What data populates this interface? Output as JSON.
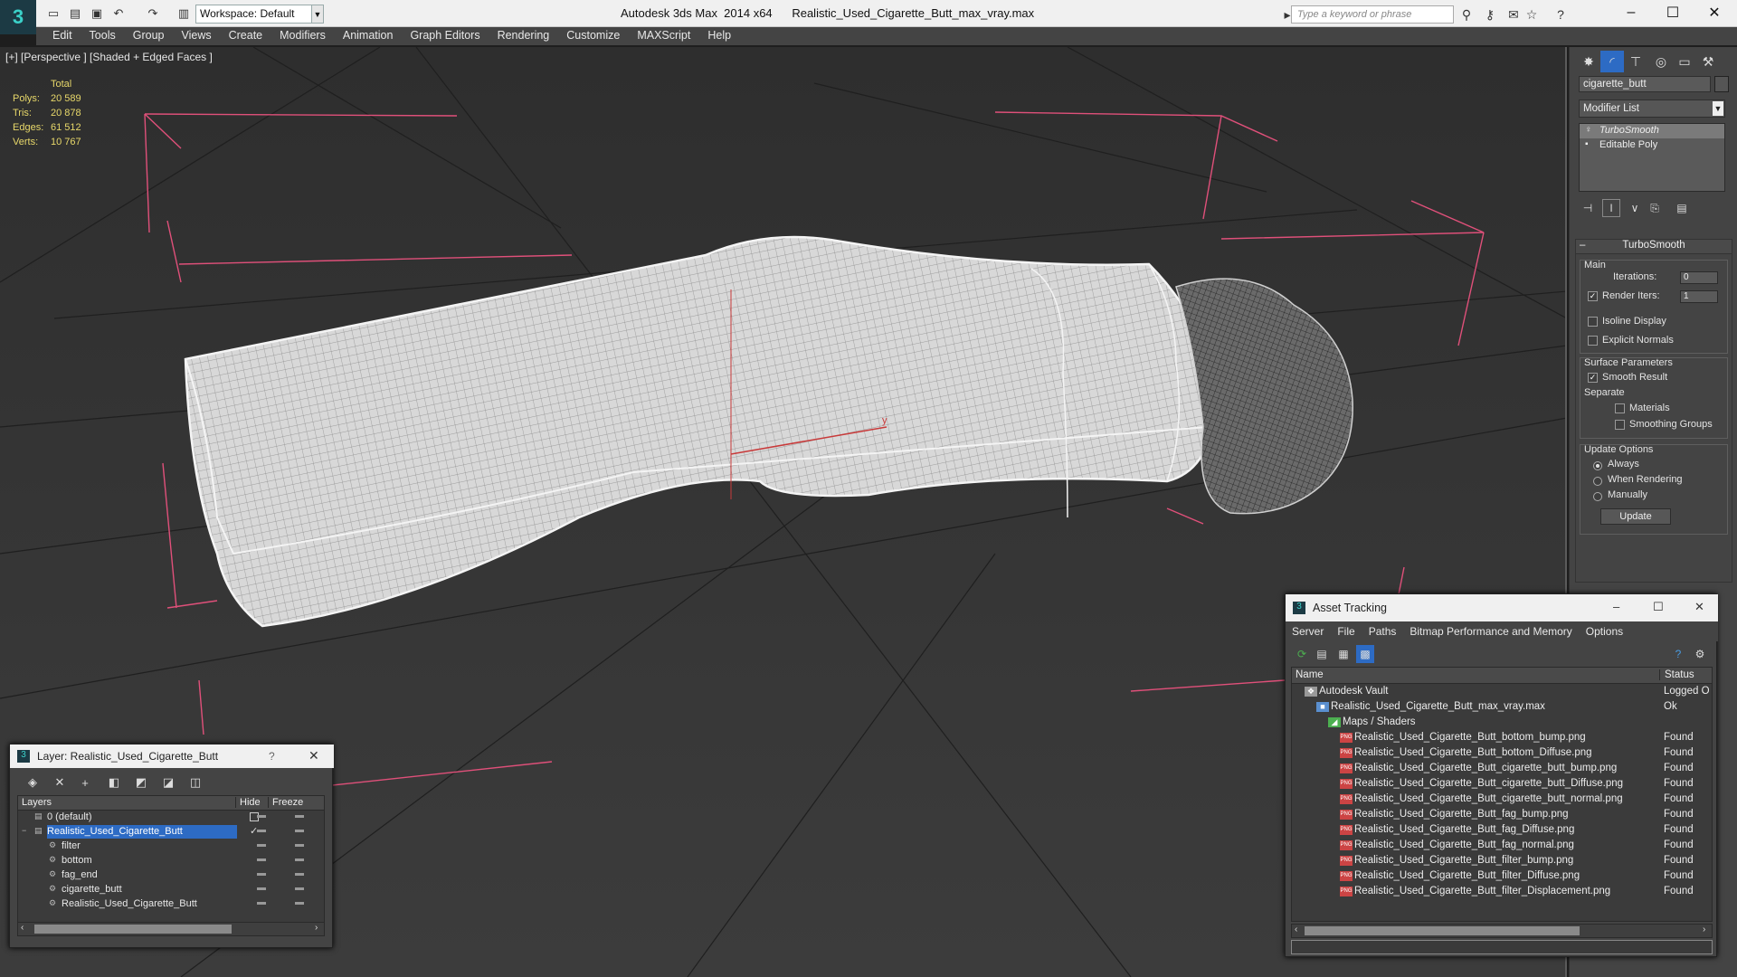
{
  "titlebar": {
    "workspace": "Workspace: Default",
    "title": "Autodesk 3ds Max  2014 x64      Realistic_Used_Cigarette_Butt_max_vray.max",
    "search_placeholder": "Type a keyword or phrase"
  },
  "menu": [
    "Edit",
    "Tools",
    "Group",
    "Views",
    "Create",
    "Modifiers",
    "Animation",
    "Graph Editors",
    "Rendering",
    "Customize",
    "MAXScript",
    "Help"
  ],
  "viewport": {
    "label": "[+] [Perspective ] [Shaded + Edged Faces ]",
    "stats": {
      "header": "Total",
      "rows": [
        {
          "k": "Polys:",
          "v": "20 589"
        },
        {
          "k": "Tris:",
          "v": "20 878"
        },
        {
          "k": "Edges:",
          "v": "61 512"
        },
        {
          "k": "Verts:",
          "v": "10 767"
        }
      ]
    },
    "axis_label": "y"
  },
  "command_panel": {
    "object_name": "cigarette_butt",
    "modifier_list": "Modifier List",
    "stack": [
      "TurboSmooth",
      "Editable Poly"
    ],
    "turbosmooth": {
      "title": "TurboSmooth",
      "main": "Main",
      "iterations_label": "Iterations:",
      "iterations": "0",
      "render_iters_label": "Render Iters:",
      "render_iters": "1",
      "render_iters_checked": true,
      "isoline": "Isoline Display",
      "explicit": "Explicit Normals",
      "surface_params": "Surface Parameters",
      "smooth_result": "Smooth Result",
      "separate": "Separate",
      "materials": "Materials",
      "smoothing_groups": "Smoothing Groups",
      "update_options": "Update Options",
      "always": "Always",
      "when_rendering": "When Rendering",
      "manually": "Manually",
      "update": "Update"
    }
  },
  "layer_window": {
    "title": "Layer: Realistic_Used_Cigarette_Butt",
    "help": "?",
    "headers": {
      "layers": "Layers",
      "hide": "Hide",
      "freeze": "Freeze"
    },
    "rows": [
      {
        "name": "0 (default)",
        "indent": 0
      },
      {
        "name": "Realistic_Used_Cigarette_Butt",
        "indent": 0
      },
      {
        "name": "filter",
        "indent": 1
      },
      {
        "name": "bottom",
        "indent": 1
      },
      {
        "name": "fag_end",
        "indent": 1
      },
      {
        "name": "cigarette_butt",
        "indent": 1
      },
      {
        "name": "Realistic_Used_Cigarette_Butt",
        "indent": 1
      }
    ]
  },
  "asset_tracking": {
    "title": "Asset Tracking",
    "menu": [
      "Server",
      "File",
      "Paths",
      "Bitmap Performance and Memory",
      "Options"
    ],
    "headers": {
      "name": "Name",
      "status": "Status"
    },
    "rows": [
      {
        "name": "Autodesk Vault",
        "status": "Logged O",
        "level": 0,
        "icon": "vault"
      },
      {
        "name": "Realistic_Used_Cigarette_Butt_max_vray.max",
        "status": "Ok",
        "level": 1,
        "icon": "max"
      },
      {
        "name": "Maps / Shaders",
        "status": "",
        "level": 2,
        "icon": "maps"
      },
      {
        "name": "Realistic_Used_Cigarette_Butt_bottom_bump.png",
        "status": "Found",
        "level": 3,
        "icon": "png"
      },
      {
        "name": "Realistic_Used_Cigarette_Butt_bottom_Diffuse.png",
        "status": "Found",
        "level": 3,
        "icon": "png"
      },
      {
        "name": "Realistic_Used_Cigarette_Butt_cigarette_butt_bump.png",
        "status": "Found",
        "level": 3,
        "icon": "png"
      },
      {
        "name": "Realistic_Used_Cigarette_Butt_cigarette_butt_Diffuse.png",
        "status": "Found",
        "level": 3,
        "icon": "png"
      },
      {
        "name": "Realistic_Used_Cigarette_Butt_cigarette_butt_normal.png",
        "status": "Found",
        "level": 3,
        "icon": "png"
      },
      {
        "name": "Realistic_Used_Cigarette_Butt_fag_bump.png",
        "status": "Found",
        "level": 3,
        "icon": "png"
      },
      {
        "name": "Realistic_Used_Cigarette_Butt_fag_Diffuse.png",
        "status": "Found",
        "level": 3,
        "icon": "png"
      },
      {
        "name": "Realistic_Used_Cigarette_Butt_fag_normal.png",
        "status": "Found",
        "level": 3,
        "icon": "png"
      },
      {
        "name": "Realistic_Used_Cigarette_Butt_filter_bump.png",
        "status": "Found",
        "level": 3,
        "icon": "png"
      },
      {
        "name": "Realistic_Used_Cigarette_Butt_filter_Diffuse.png",
        "status": "Found",
        "level": 3,
        "icon": "png"
      },
      {
        "name": "Realistic_Used_Cigarette_Butt_filter_Displacement.png",
        "status": "Found",
        "level": 3,
        "icon": "png"
      }
    ]
  },
  "colors": {
    "selection": "#2d6bc4",
    "stats_yellow": "#e8d86a",
    "bbox_pink": "#e0507a"
  }
}
